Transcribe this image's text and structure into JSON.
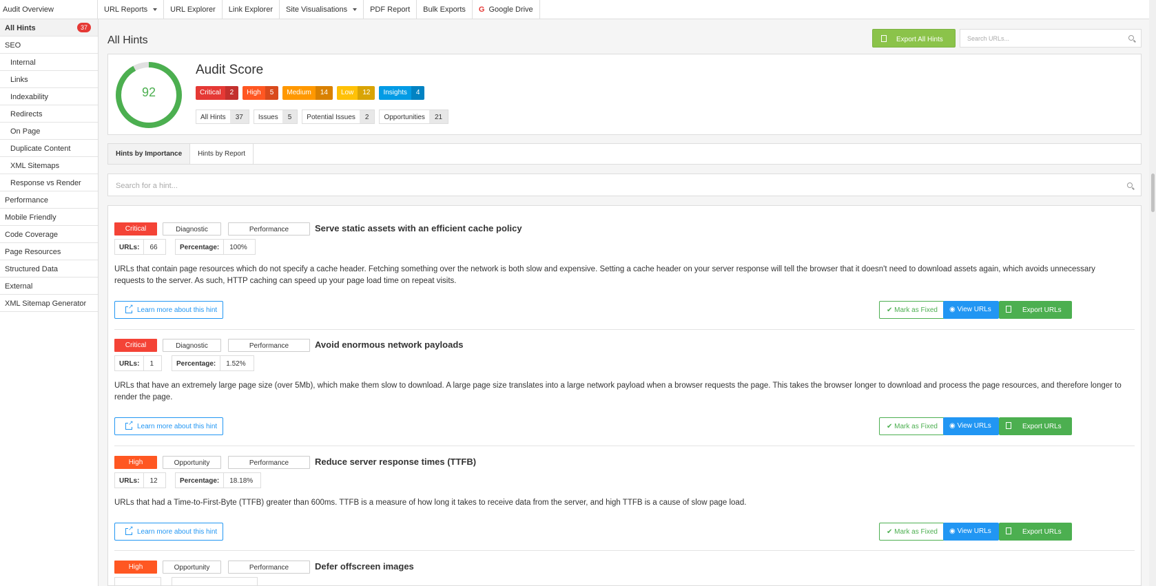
{
  "topnav": {
    "first": "Audit Overview",
    "items": [
      {
        "label": "URL Reports",
        "dropdown": true
      },
      {
        "label": "URL Explorer",
        "dropdown": false
      },
      {
        "label": "Link Explorer",
        "dropdown": false
      },
      {
        "label": "Site Visualisations",
        "dropdown": true
      },
      {
        "label": "PDF Report",
        "dropdown": false
      },
      {
        "label": "Bulk Exports",
        "dropdown": false
      },
      {
        "label": "Google Drive",
        "dropdown": false,
        "icon": "google-icon",
        "icon_glyph": "G"
      }
    ]
  },
  "sidebar": {
    "all_hints_badge": "37",
    "items": [
      {
        "label": "All Hints"
      },
      {
        "label": "SEO"
      },
      {
        "label": "Internal"
      },
      {
        "label": "Links"
      },
      {
        "label": "Indexability"
      },
      {
        "label": "Redirects"
      },
      {
        "label": "On Page"
      },
      {
        "label": "Duplicate Content"
      },
      {
        "label": "XML Sitemaps"
      },
      {
        "label": "Response vs Render"
      },
      {
        "label": "Performance"
      },
      {
        "label": "Mobile Friendly"
      },
      {
        "label": "Code Coverage"
      },
      {
        "label": "Page Resources"
      },
      {
        "label": "Structured Data"
      },
      {
        "label": "External"
      },
      {
        "label": "XML Sitemap Generator"
      }
    ]
  },
  "header": {
    "title": "All Hints",
    "export_all": "Export All Hints",
    "search_placeholder": "Search URLs..."
  },
  "score": {
    "value": "92",
    "score_fraction": 0.92,
    "title": "Audit Score",
    "severities": [
      {
        "label": "Critical",
        "count": "2",
        "color": "#e53935"
      },
      {
        "label": "High",
        "count": "5",
        "color": "#ff5722"
      },
      {
        "label": "Medium",
        "count": "14",
        "color": "#ff9800"
      },
      {
        "label": "Low",
        "count": "12",
        "color": "#ffc107"
      },
      {
        "label": "Insights",
        "count": "4",
        "color": "#039be5"
      }
    ],
    "counts": [
      {
        "label": "All Hints",
        "count": "37"
      },
      {
        "label": "Issues",
        "count": "5"
      },
      {
        "label": "Potential Issues",
        "count": "2"
      },
      {
        "label": "Opportunities",
        "count": "21"
      }
    ],
    "ring_color": "#4caf50"
  },
  "tabs": [
    "Hints by Importance",
    "Hints by Report"
  ],
  "hint_search_placeholder": "Search for a hint...",
  "hint_labels": {
    "urls": "URLs:",
    "percentage": "Percentage:",
    "learn_more": "Learn more about this hint",
    "mark_fixed": "✔ Mark as Fixed",
    "view_urls": "View URLs",
    "export_urls": "Export URLs"
  },
  "hints": [
    {
      "severity": "Critical",
      "severity_color": "#f44336",
      "type": "Diagnostic",
      "category": "Performance",
      "title": "Serve static assets with an efficient cache policy",
      "urls": "66",
      "percentage": "100%",
      "description": "URLs that contain page resources which do not specify a cache header. Fetching something over the network is both slow and expensive. Setting a cache header on your server response will tell the browser that it doesn't need to download assets again, which avoids unnecessary requests to the server. As such, HTTP caching can speed up your page load time on repeat visits."
    },
    {
      "severity": "Critical",
      "severity_color": "#f44336",
      "type": "Diagnostic",
      "category": "Performance",
      "title": "Avoid enormous network payloads",
      "urls": "1",
      "percentage": "1.52%",
      "description": "URLs that have an extremely large page size (over 5Mb), which make them slow to download. A large page size translates into a large network payload when a browser requests the page. This takes the browser longer to download and process the page resources, and therefore longer to render the page."
    },
    {
      "severity": "High",
      "severity_color": "#ff5722",
      "type": "Opportunity",
      "category": "Performance",
      "title": "Reduce server response times (TTFB)",
      "urls": "12",
      "percentage": "18.18%",
      "description": "URLs that had a Time-to-First-Byte (TTFB) greater than 600ms. TTFB is a measure of how long it takes to receive data from the server, and high TTFB is a cause of slow page load."
    },
    {
      "severity": "High",
      "severity_color": "#ff5722",
      "type": "Opportunity",
      "category": "Performance",
      "title": "Defer offscreen images"
    }
  ]
}
